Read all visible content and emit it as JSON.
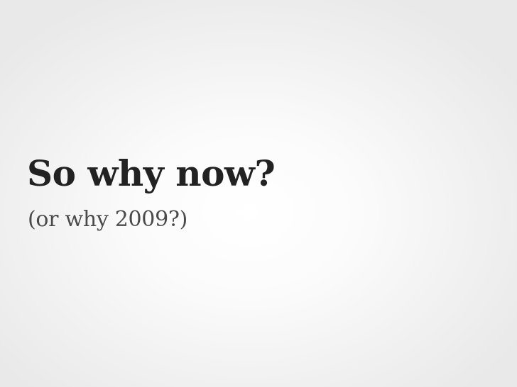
{
  "slide": {
    "title": "So why now?",
    "subtitle": "(or why 2009?)"
  }
}
